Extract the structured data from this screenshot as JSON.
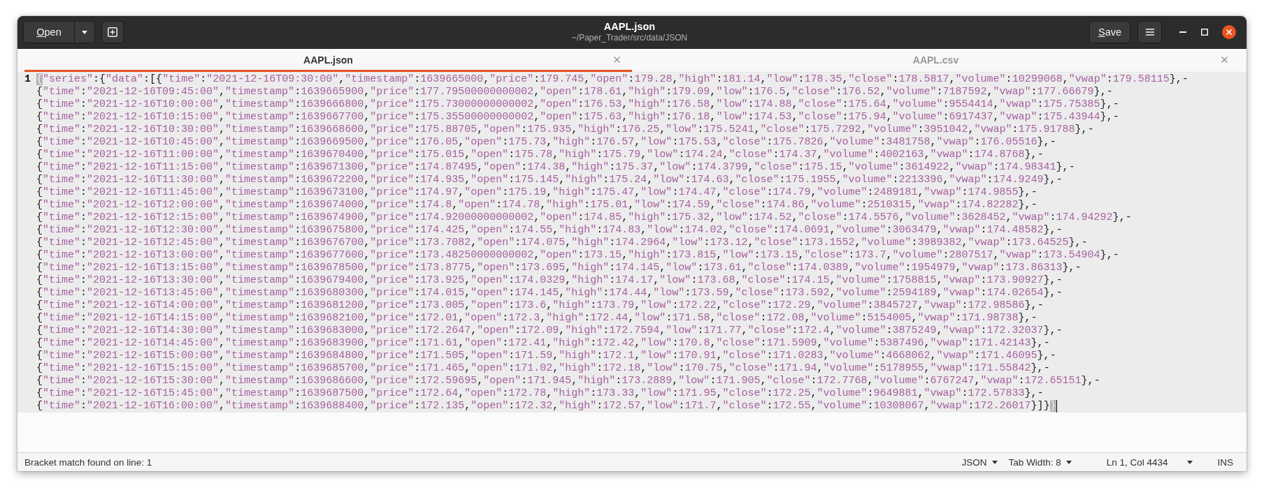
{
  "window": {
    "title": "AAPL.json",
    "subtitle": "~/Paper_Trader/src/data/JSON"
  },
  "header": {
    "open_button": "Open",
    "save_button": "Save"
  },
  "tabs": [
    {
      "label": "AAPL.json",
      "selected": true
    },
    {
      "label": "AAPL.csv",
      "selected": false
    }
  ],
  "editor": {
    "bracket_match": {
      "open": "{",
      "close": "}"
    },
    "cursor": true,
    "lines": [
      {
        "number": "1",
        "current": true,
        "rows": [
          "\"series\":{\"data\":[{\"time\":\"2021-12-16T09:30:00\",\"timestamp\":1639665000,\"price\":179.745,\"open\":179.28,\"high\":181.14,\"low\":178.35,\"close\":178.5817,\"volume\":10299068,\"vwap\":179.58115},-",
          "{\"time\":\"2021-12-16T09:45:00\",\"timestamp\":1639665900,\"price\":177.79500000000002,\"open\":178.61,\"high\":179.09,\"low\":176.5,\"close\":176.52,\"volume\":7187592,\"vwap\":177.66679},-",
          "{\"time\":\"2021-12-16T10:00:00\",\"timestamp\":1639666800,\"price\":175.73000000000002,\"open\":176.53,\"high\":176.58,\"low\":174.88,\"close\":175.64,\"volume\":9554414,\"vwap\":175.75385},-",
          "{\"time\":\"2021-12-16T10:15:00\",\"timestamp\":1639667700,\"price\":175.35500000000002,\"open\":175.63,\"high\":176.18,\"low\":174.53,\"close\":175.94,\"volume\":6917437,\"vwap\":175.43944},-",
          "{\"time\":\"2021-12-16T10:30:00\",\"timestamp\":1639668600,\"price\":175.88705,\"open\":175.935,\"high\":176.25,\"low\":175.5241,\"close\":175.7292,\"volume\":3951042,\"vwap\":175.91788},-",
          "{\"time\":\"2021-12-16T10:45:00\",\"timestamp\":1639669500,\"price\":176.05,\"open\":175.73,\"high\":176.57,\"low\":175.53,\"close\":175.7826,\"volume\":3481758,\"vwap\":176.05516},-",
          "{\"time\":\"2021-12-16T11:00:00\",\"timestamp\":1639670400,\"price\":175.015,\"open\":175.78,\"high\":175.79,\"low\":174.24,\"close\":174.37,\"volume\":4002163,\"vwap\":174.8768},-",
          "{\"time\":\"2021-12-16T11:15:00\",\"timestamp\":1639671300,\"price\":174.87495,\"open\":174.38,\"high\":175.37,\"low\":174.3799,\"close\":175.15,\"volume\":3614922,\"vwap\":174.98341},-",
          "{\"time\":\"2021-12-16T11:30:00\",\"timestamp\":1639672200,\"price\":174.935,\"open\":175.145,\"high\":175.24,\"low\":174.63,\"close\":175.1955,\"volume\":2213396,\"vwap\":174.9249},-",
          "{\"time\":\"2021-12-16T11:45:00\",\"timestamp\":1639673100,\"price\":174.97,\"open\":175.19,\"high\":175.47,\"low\":174.47,\"close\":174.79,\"volume\":2489181,\"vwap\":174.9855},-",
          "{\"time\":\"2021-12-16T12:00:00\",\"timestamp\":1639674000,\"price\":174.8,\"open\":174.78,\"high\":175.01,\"low\":174.59,\"close\":174.86,\"volume\":2510315,\"vwap\":174.82282},-",
          "{\"time\":\"2021-12-16T12:15:00\",\"timestamp\":1639674900,\"price\":174.92000000000002,\"open\":174.85,\"high\":175.32,\"low\":174.52,\"close\":174.5576,\"volume\":3628452,\"vwap\":174.94292},-",
          "{\"time\":\"2021-12-16T12:30:00\",\"timestamp\":1639675800,\"price\":174.425,\"open\":174.55,\"high\":174.83,\"low\":174.02,\"close\":174.0691,\"volume\":3063479,\"vwap\":174.48582},-",
          "{\"time\":\"2021-12-16T12:45:00\",\"timestamp\":1639676700,\"price\":173.7082,\"open\":174.075,\"high\":174.2964,\"low\":173.12,\"close\":173.1552,\"volume\":3989382,\"vwap\":173.64525},-",
          "{\"time\":\"2021-12-16T13:00:00\",\"timestamp\":1639677600,\"price\":173.48250000000002,\"open\":173.15,\"high\":173.815,\"low\":173.15,\"close\":173.7,\"volume\":2807517,\"vwap\":173.54904},-",
          "{\"time\":\"2021-12-16T13:15:00\",\"timestamp\":1639678500,\"price\":173.8775,\"open\":173.695,\"high\":174.145,\"low\":173.61,\"close\":174.0389,\"volume\":1954979,\"vwap\":173.86313},-",
          "{\"time\":\"2021-12-16T13:30:00\",\"timestamp\":1639679400,\"price\":173.925,\"open\":174.0329,\"high\":174.17,\"low\":173.68,\"close\":174.15,\"volume\":1758815,\"vwap\":173.90927},-",
          "{\"time\":\"2021-12-16T13:45:00\",\"timestamp\":1639680300,\"price\":174.015,\"open\":174.145,\"high\":174.44,\"low\":173.59,\"close\":173.592,\"volume\":2594189,\"vwap\":174.02654},-",
          "{\"time\":\"2021-12-16T14:00:00\",\"timestamp\":1639681200,\"price\":173.005,\"open\":173.6,\"high\":173.79,\"low\":172.22,\"close\":172.29,\"volume\":3845727,\"vwap\":172.98586},-",
          "{\"time\":\"2021-12-16T14:15:00\",\"timestamp\":1639682100,\"price\":172.01,\"open\":172.3,\"high\":172.44,\"low\":171.58,\"close\":172.08,\"volume\":5154005,\"vwap\":171.98738},-",
          "{\"time\":\"2021-12-16T14:30:00\",\"timestamp\":1639683000,\"price\":172.2647,\"open\":172.09,\"high\":172.7594,\"low\":171.77,\"close\":172.4,\"volume\":3875249,\"vwap\":172.32037},-",
          "{\"time\":\"2021-12-16T14:45:00\",\"timestamp\":1639683900,\"price\":171.61,\"open\":172.41,\"high\":172.42,\"low\":170.8,\"close\":171.5909,\"volume\":5387496,\"vwap\":171.42143},-",
          "{\"time\":\"2021-12-16T15:00:00\",\"timestamp\":1639684800,\"price\":171.505,\"open\":171.59,\"high\":172.1,\"low\":170.91,\"close\":171.0283,\"volume\":4668062,\"vwap\":171.46095},-",
          "{\"time\":\"2021-12-16T15:15:00\",\"timestamp\":1639685700,\"price\":171.465,\"open\":171.02,\"high\":172.18,\"low\":170.75,\"close\":171.94,\"volume\":5178955,\"vwap\":171.55842},-",
          "{\"time\":\"2021-12-16T15:30:00\",\"timestamp\":1639686600,\"price\":172.59695,\"open\":171.945,\"high\":173.2889,\"low\":171.905,\"close\":172.7768,\"volume\":6767247,\"vwap\":172.65151},-",
          "{\"time\":\"2021-12-16T15:45:00\",\"timestamp\":1639687500,\"price\":172.64,\"open\":172.78,\"high\":173.33,\"low\":171.95,\"close\":172.25,\"volume\":9649881,\"vwap\":172.57833},-",
          "{\"time\":\"2021-12-16T16:00:00\",\"timestamp\":1639688400,\"price\":172.135,\"open\":172.32,\"high\":172.57,\"low\":171.7,\"close\":172.55,\"volume\":10308067,\"vwap\":172.26017}]}"
        ]
      }
    ]
  },
  "status_bar": {
    "message": "Bracket match found on line: 1",
    "language": "JSON",
    "tab_width": "Tab Width: 8",
    "position": "Ln 1, Col 4434",
    "mode": "INS"
  }
}
